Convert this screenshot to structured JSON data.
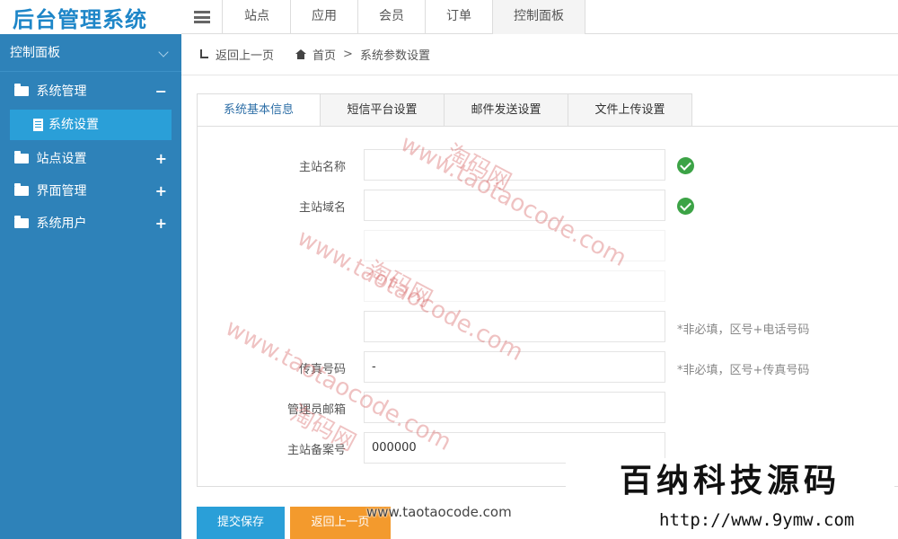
{
  "app": {
    "title": "后台管理系统"
  },
  "topnav": [
    {
      "label": "站点"
    },
    {
      "label": "应用"
    },
    {
      "label": "会员"
    },
    {
      "label": "订单"
    },
    {
      "label": "控制面板",
      "active": true
    }
  ],
  "sidebar": {
    "header": "控制面板",
    "groups": [
      {
        "label": "系统管理",
        "toggle": "−",
        "expanded": true,
        "children": [
          {
            "label": "系统设置",
            "active": true
          }
        ]
      },
      {
        "label": "站点设置",
        "toggle": "+"
      },
      {
        "label": "界面管理",
        "toggle": "+"
      },
      {
        "label": "系统用户",
        "toggle": "+"
      }
    ]
  },
  "breadcrumb": {
    "back": "返回上一页",
    "home": "首页",
    "separator": ">",
    "current": "系统参数设置"
  },
  "tabs": [
    {
      "label": "系统基本信息",
      "active": true
    },
    {
      "label": "短信平台设置"
    },
    {
      "label": "邮件发送设置"
    },
    {
      "label": "文件上传设置"
    }
  ],
  "form": {
    "site_name": {
      "label": "主站名称",
      "value": ""
    },
    "site_domain": {
      "label": "主站域名",
      "value": ""
    },
    "phone": {
      "value": "",
      "hint": "*非必填，区号+电话号码"
    },
    "fax": {
      "label": "传真号码",
      "value": "-",
      "hint": "*非必填，区号+传真号码"
    },
    "admin_email": {
      "label": "管理员邮箱",
      "value": ""
    },
    "icp": {
      "label": "主站备案号",
      "value": "000000"
    }
  },
  "buttons": {
    "save": "提交保存",
    "back": "返回上一页"
  },
  "watermarks": {
    "url": "www.taotaocode.com",
    "cn": "淘码网",
    "bottom": "www.taotaocode.com",
    "brand": "百纳科技源码",
    "brand_url": "http://www.9ymw.com"
  }
}
